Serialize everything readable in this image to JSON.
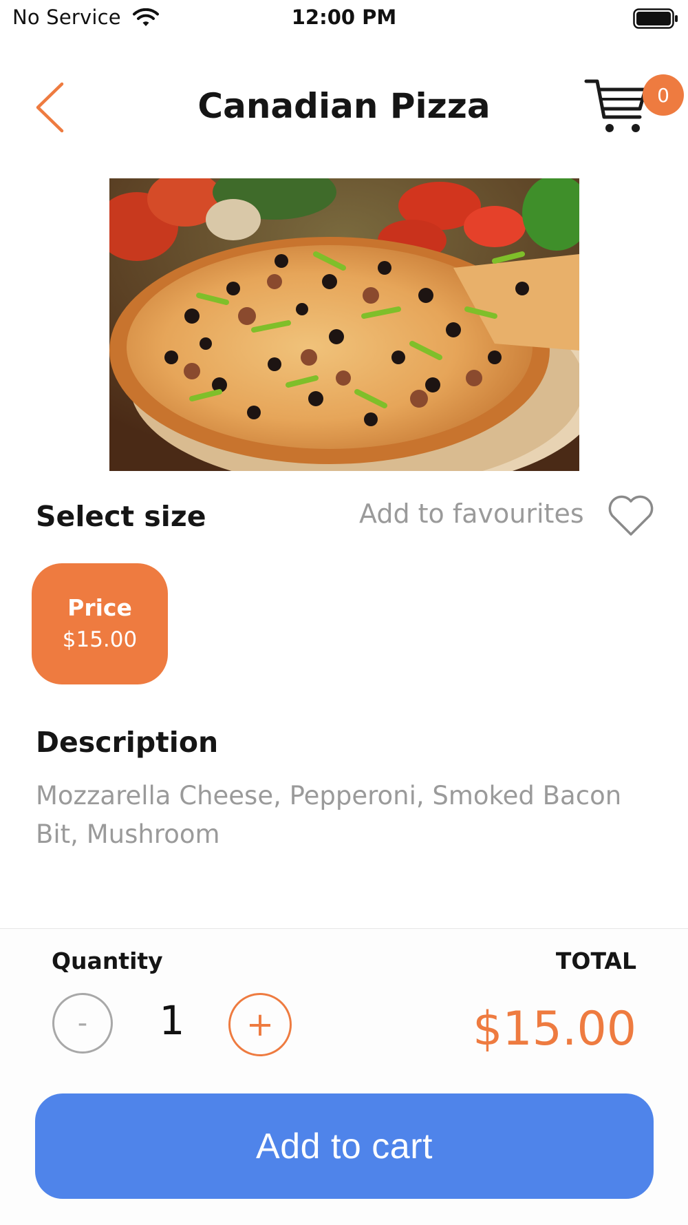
{
  "status_bar": {
    "carrier": "No Service",
    "time": "12:00 PM"
  },
  "header": {
    "title": "Canadian Pizza",
    "cart_count": "0"
  },
  "product": {
    "image_alt": "pizza"
  },
  "size": {
    "label": "Select size",
    "favourites_label": "Add to favourites",
    "option": {
      "label": "Price",
      "price": "$15.00"
    }
  },
  "description": {
    "title": "Description",
    "text": "Mozzarella Cheese, Pepperoni, Smoked Bacon Bit, Mushroom"
  },
  "order": {
    "quantity_label": "Quantity",
    "total_label": "TOTAL",
    "minus": "-",
    "plus": "+",
    "quantity": "1",
    "total": "$15.00",
    "add_to_cart": "Add to cart"
  },
  "colors": {
    "accent": "#ee7b40",
    "primary_button": "#4f84ea",
    "muted_text": "#9a9a9a"
  },
  "icons": [
    "wifi-icon",
    "battery-icon",
    "back-chevron-icon",
    "cart-icon",
    "heart-icon"
  ]
}
